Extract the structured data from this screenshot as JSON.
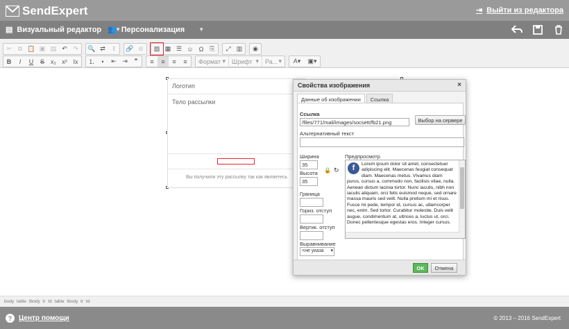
{
  "header": {
    "brand": "SendExpert",
    "exit_label": "Выйти из редактора"
  },
  "modebar": {
    "visual_editor": "Визуальный редактор",
    "personalization": "Персонализация"
  },
  "toolbar": {
    "format_label": "Формат",
    "font_label": "Шрифт",
    "size_label": "Ра..."
  },
  "email": {
    "logo_placeholder": "Логотип",
    "body_placeholder": "Тело рассылки",
    "footer_text": "Вы получили эту рассылку так как являетесь"
  },
  "dialog": {
    "title": "Свойства изображения",
    "close": "×",
    "tabs": [
      "Данные об изображении",
      "Ссылка"
    ],
    "link_label": "Ссылка",
    "link_value": "/files/771/mail/images/socsett/fb21.png",
    "browse_server": "Выбор на сервере",
    "alt_label": "Альтернативный текст",
    "alt_value": "",
    "width_label": "Ширина",
    "width_value": "35",
    "height_label": "Высота",
    "height_value": "35",
    "border_label": "Граница",
    "hspace_label": "Гориз. отступ",
    "vspace_label": "Вертик. отступ",
    "align_label": "Выравнивание",
    "align_value": "<не указа",
    "preview_label": "Предпросмотр",
    "preview_text": "Lorem ipsum dolor sit amet, consectetuer adipiscing elit. Maecenas feugiat consequat diam. Maecenas metus. Vivamus diam purus, cursus a, commodo non, facilisis vitae, nulla. Aenean dictum lacinia tortor. Nunc iaculis, nibh non iaculis aliquam, orci felis euismod neque, sed ornare massa mauris sed velit. Nulla pretium mi et risus. Fusce mi pede, tempor id, cursus ac, ullamcorper nec, enim. Sed tortor. Curabitur molestie. Duis velit augue, condimentum at, ultrices a, luctus ut, orci. Donec pellentesque egestas eros. Integer cursus.",
    "ok": "OK",
    "cancel": "Отмена"
  },
  "pathbar": "body table tbody tr td table tbody tr td",
  "footer": {
    "help": "Центр помощи",
    "copyright": "© 2013 – 2016 SendExpert"
  }
}
